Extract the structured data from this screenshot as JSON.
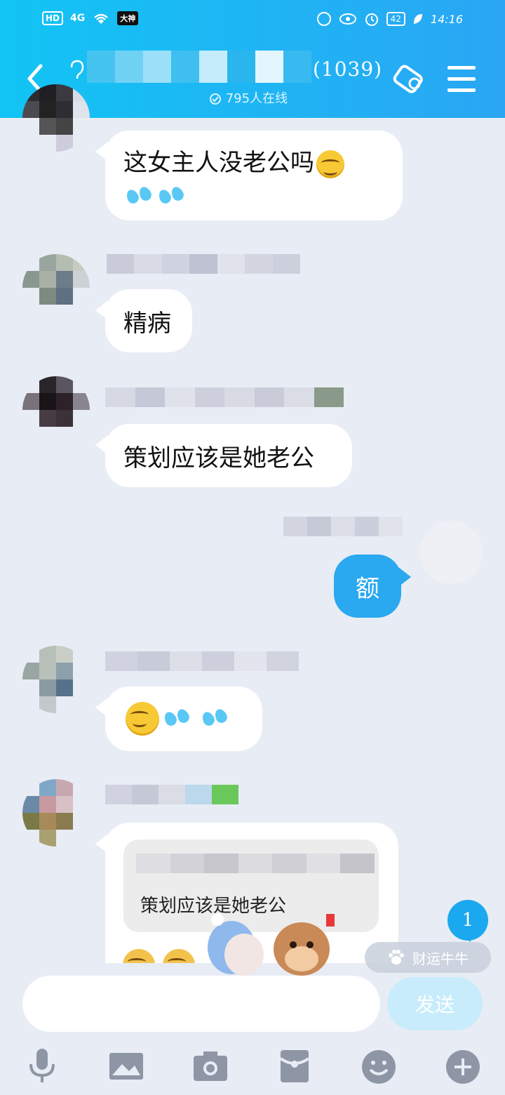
{
  "status_bar": {
    "network": "HD",
    "signal": "4G",
    "app_badge": "大神",
    "battery": "42",
    "time": "14:16"
  },
  "header": {
    "group_count": "(1039)",
    "online": "795人在线"
  },
  "messages": [
    {
      "side": "left",
      "text": "这女主人没老公吗",
      "emojis_after": [
        "grin"
      ],
      "second_line_emojis": [
        "sweat",
        "sweat"
      ]
    },
    {
      "side": "left",
      "text": "精病"
    },
    {
      "side": "left",
      "text": "策划应该是她老公"
    },
    {
      "side": "right",
      "text": "额"
    },
    {
      "side": "left",
      "text": "",
      "emojis": [
        "grin",
        "sweat",
        "sweat"
      ]
    },
    {
      "side": "left",
      "quote_text": "策划应该是她老公"
    }
  ],
  "floating": {
    "unread_count": "1",
    "pet_label": "财运牛牛"
  },
  "composer": {
    "send_label": "发送"
  },
  "toolbar": {
    "items": [
      "mic-icon",
      "image-icon",
      "camera-icon",
      "red-packet-icon",
      "emoji-icon",
      "plus-icon"
    ]
  },
  "colors": {
    "accent": "#2aa8f0",
    "header": "#12c4f4",
    "background": "#e8ecf4"
  }
}
